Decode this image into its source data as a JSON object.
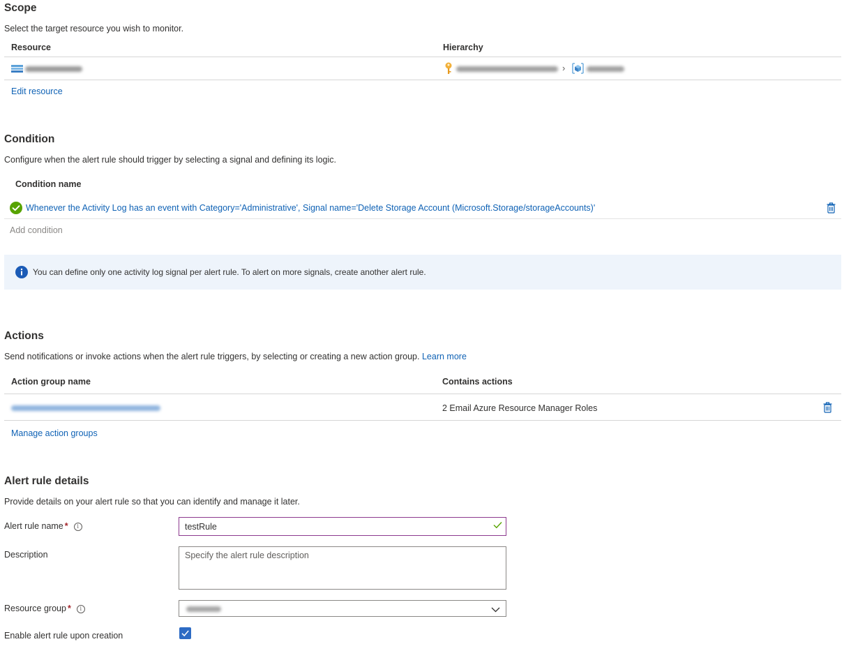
{
  "scope": {
    "title": "Scope",
    "description": "Select the target resource you wish to monitor.",
    "columns": {
      "resource": "Resource",
      "hierarchy": "Hierarchy"
    },
    "edit_link": "Edit resource"
  },
  "condition": {
    "title": "Condition",
    "description": "Configure when the alert rule should trigger by selecting a signal and defining its logic.",
    "column": "Condition name",
    "rows": [
      {
        "name": "Whenever the Activity Log has an event with Category='Administrative', Signal name='Delete Storage Account (Microsoft.Storage/storageAccounts)'"
      }
    ],
    "add_link": "Add condition",
    "info": "You can define only one activity log signal per alert rule. To alert on more signals, create another alert rule."
  },
  "actions": {
    "title": "Actions",
    "description": "Send notifications or invoke actions when the alert rule triggers, by selecting or creating a new action group.",
    "learn_more": "Learn more",
    "columns": {
      "group": "Action group name",
      "contains": "Contains actions"
    },
    "rows": [
      {
        "contains": "2 Email Azure Resource Manager Roles"
      }
    ],
    "manage_link": "Manage action groups"
  },
  "details": {
    "title": "Alert rule details",
    "description": "Provide details on your alert rule so that you can identify and manage it later.",
    "name_label": "Alert rule name",
    "name_value": "testRule",
    "description_label": "Description",
    "description_placeholder": "Specify the alert rule description",
    "resource_group_label": "Resource group",
    "enable_label": "Enable alert rule upon creation",
    "enable_checked": true
  },
  "colors": {
    "link": "#0f62b5",
    "success": "#57a300",
    "info_bg": "#eef4fb",
    "checkbox": "#2d6bc4",
    "required": "#a4262c"
  }
}
